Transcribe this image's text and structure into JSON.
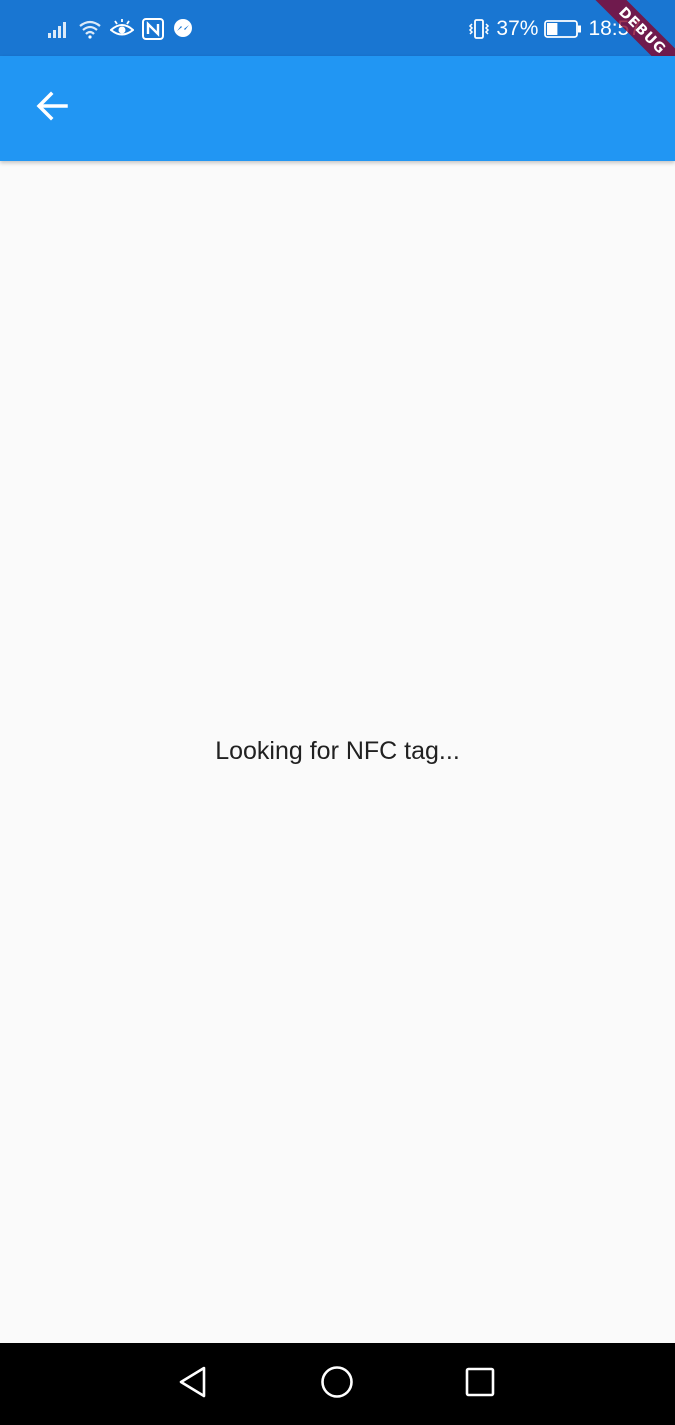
{
  "status_bar": {
    "battery_percent": "37%",
    "time": "18:57",
    "left_icons": [
      "signal-icon",
      "wifi-icon",
      "eye-comfort-icon",
      "nfc-icon",
      "messenger-icon"
    ],
    "right_icons": [
      "vibrate-icon",
      "battery-icon"
    ],
    "battery_level": 0.37
  },
  "app_bar": {
    "back_icon": "arrow-back-icon",
    "color": "#2196f3"
  },
  "main": {
    "message": "Looking for NFC tag..."
  },
  "debug_banner": {
    "label": "DEBUG"
  },
  "nav_bar": {
    "icons": [
      "back-triangle-icon",
      "home-circle-icon",
      "recents-square-icon"
    ]
  },
  "colors": {
    "status_bar": "#1976d2",
    "app_bar": "#2196f3",
    "background": "#fafafa",
    "text": "#212121",
    "nav_bar": "#000000"
  }
}
